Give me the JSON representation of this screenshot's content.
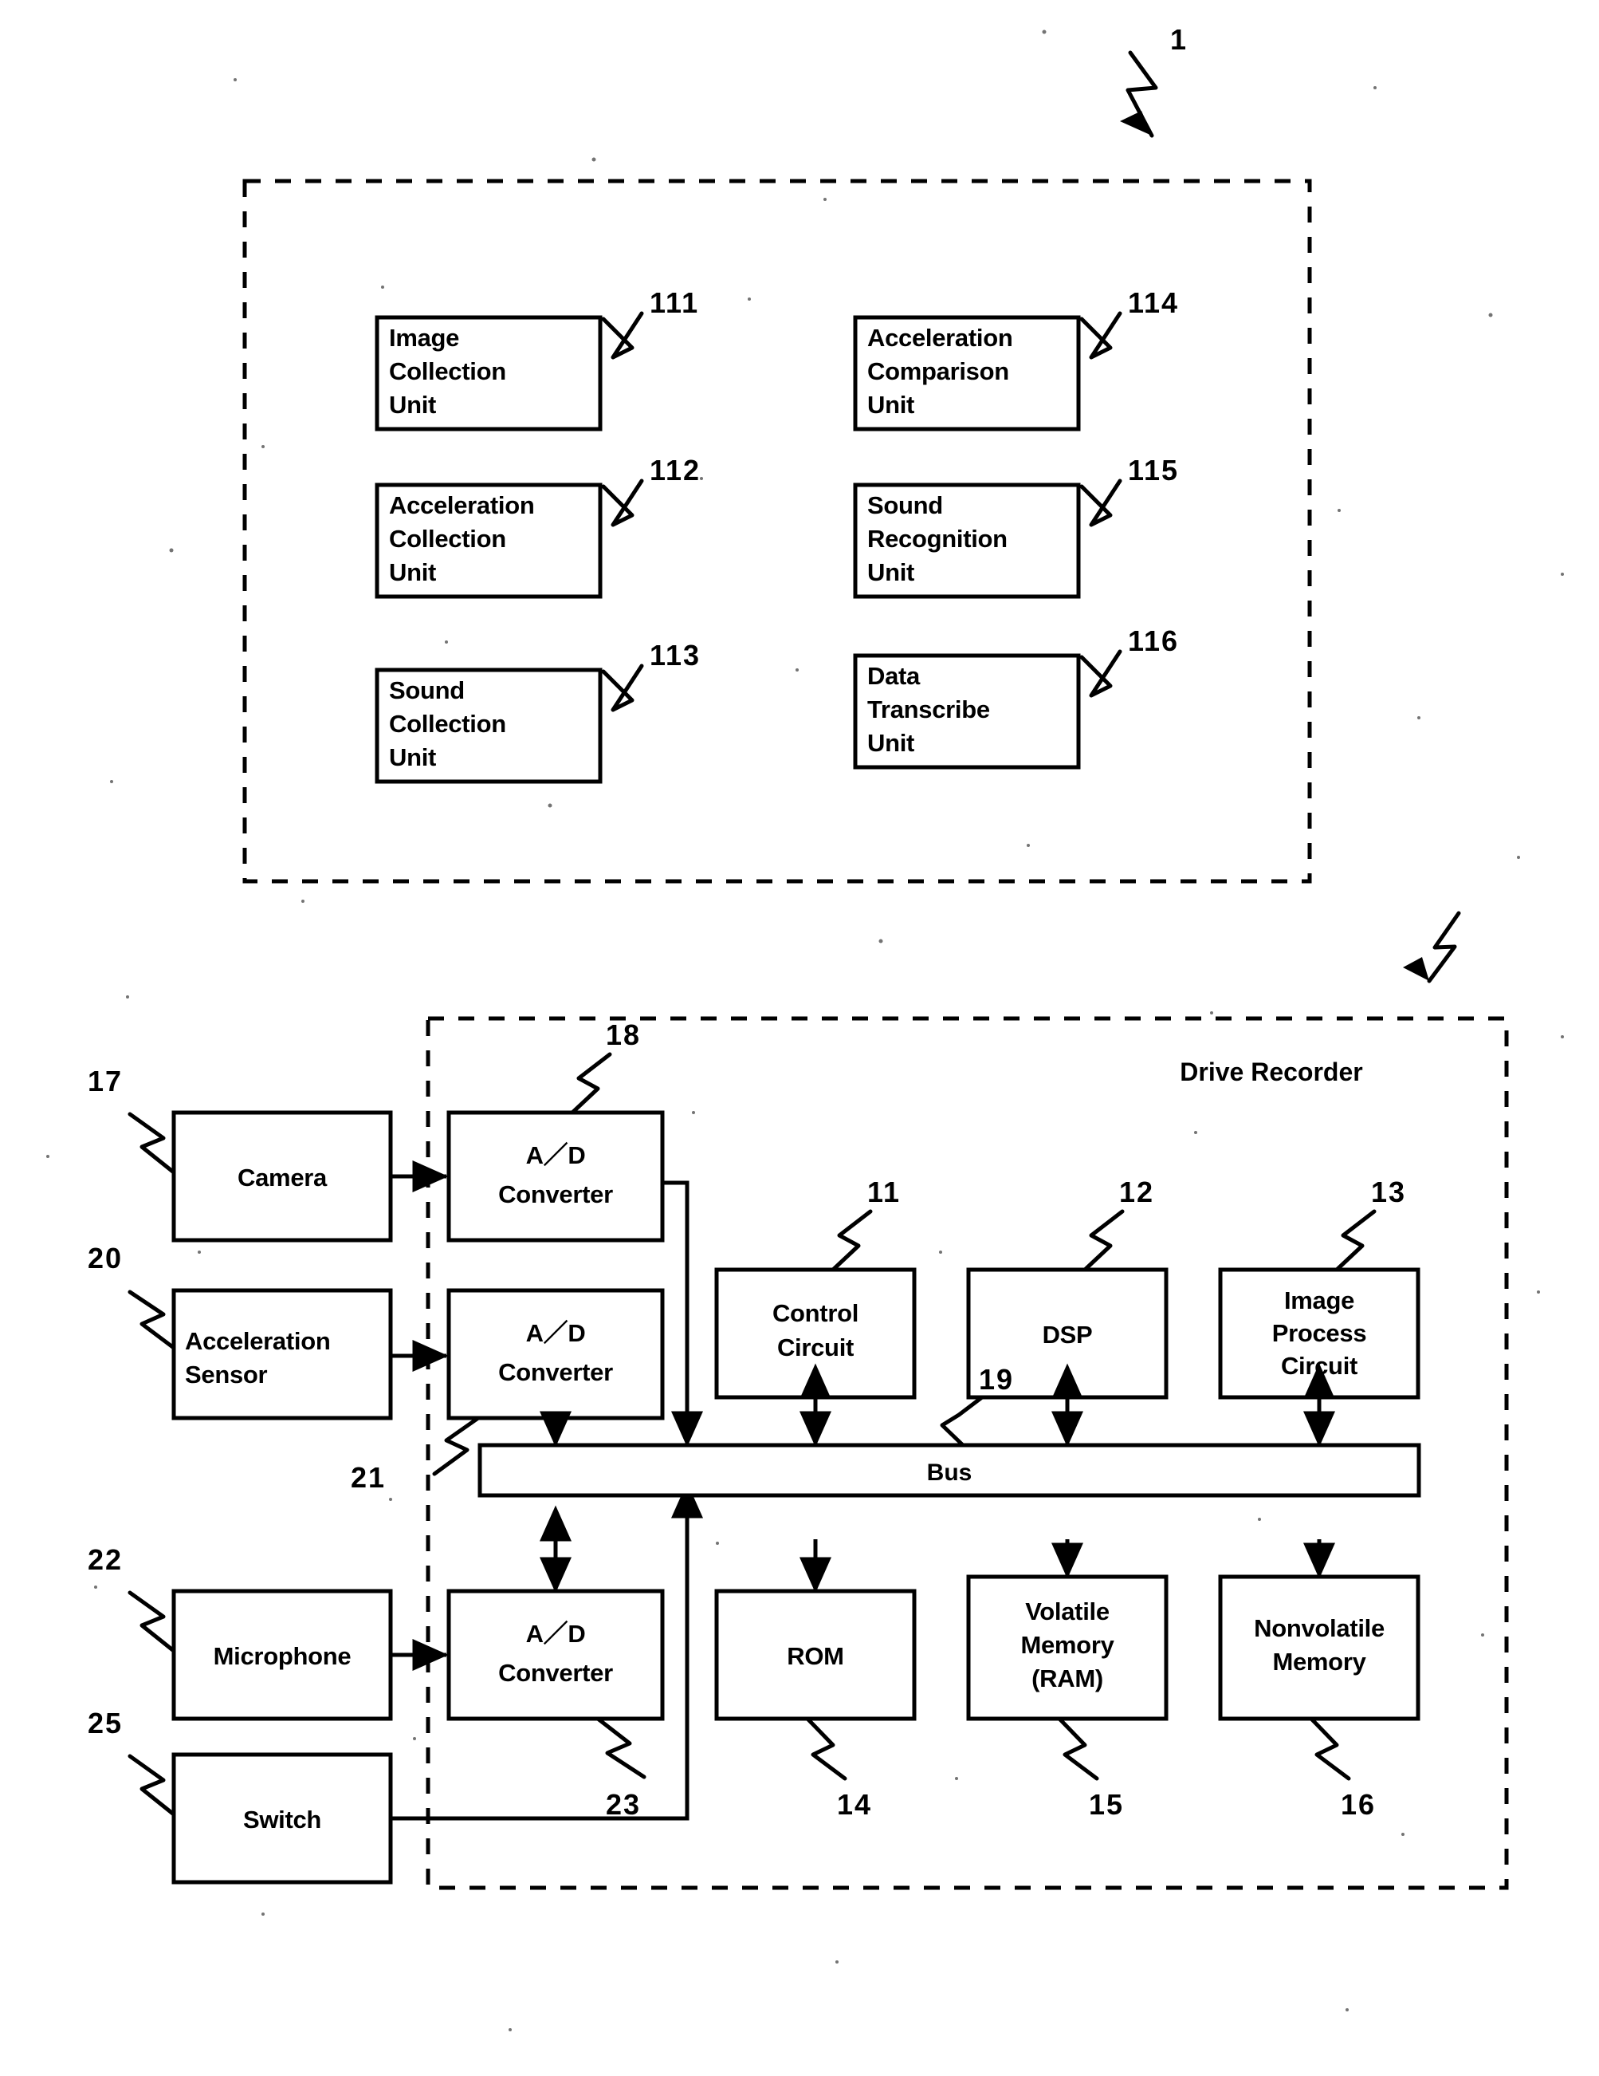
{
  "figure": {
    "top_reference": "1",
    "drive_recorder_title": "Drive Recorder",
    "bus_label": "Bus"
  },
  "upper_section": {
    "reference": "1",
    "left_column": [
      {
        "label_lines": [
          "Image",
          "Collection",
          "Unit"
        ],
        "ref": "111",
        "name": "image-collection-unit"
      },
      {
        "label_lines": [
          "Acceleration",
          "Collection",
          "Unit"
        ],
        "ref": "112",
        "name": "acceleration-collection-unit"
      },
      {
        "label_lines": [
          "Sound",
          "Collection",
          "Unit"
        ],
        "ref": "113",
        "name": "sound-collection-unit"
      }
    ],
    "right_column": [
      {
        "label_lines": [
          "Acceleration",
          "Comparison",
          "Unit"
        ],
        "ref": "114",
        "name": "acceleration-comparison-unit"
      },
      {
        "label_lines": [
          "Sound",
          "Recognition",
          "Unit"
        ],
        "ref": "115",
        "name": "sound-recognition-unit"
      },
      {
        "label_lines": [
          "Data",
          "Transcribe",
          "Unit"
        ],
        "ref": "116",
        "name": "data-transcribe-unit"
      }
    ],
    "blocks": {
      "b111_l1": "Image",
      "b111_l2": "Collection",
      "b111_l3": "Unit",
      "b112_l1": "Acceleration",
      "b112_l2": "Collection",
      "b112_l3": "Unit",
      "b113_l1": "Sound",
      "b113_l2": "Collection",
      "b113_l3": "Unit",
      "b114_l1": "Acceleration",
      "b114_l2": "Comparison",
      "b114_l3": "Unit",
      "b115_l1": "Sound",
      "b115_l2": "Recognition",
      "b115_l3": "Unit",
      "b116_l1": "Data",
      "b116_l2": "Transcribe",
      "b116_l3": "Unit",
      "r111": "111",
      "r112": "112",
      "r113": "113",
      "r114": "114",
      "r115": "115",
      "r116": "116"
    }
  },
  "lower_section": {
    "title": "Drive Recorder",
    "external_devices": {
      "camera_label": "Camera",
      "camera_ref": "17",
      "accel_l1": "Acceleration",
      "accel_l2": "Sensor",
      "accel_ref": "20",
      "mic_label": "Microphone",
      "mic_ref": "22",
      "switch_label": "Switch",
      "switch_ref": "25"
    },
    "converters": {
      "ad1_l1": "A／D",
      "ad1_l2": "Converter",
      "ad1_ref": "18",
      "ad2_l1": "A／D",
      "ad2_l2": "Converter",
      "ad2_ref": "21",
      "ad3_l1": "A／D",
      "ad3_l2": "Converter",
      "ad3_ref": "23"
    },
    "circuits": {
      "control_l1": "Control",
      "control_l2": "Circuit",
      "control_ref": "11",
      "dsp_label": "DSP",
      "dsp_ref": "12",
      "imgproc_l1": "Image",
      "imgproc_l2": "Process",
      "imgproc_l3": "Circuit",
      "imgproc_ref": "13"
    },
    "bus": {
      "label": "Bus",
      "ref": "19"
    },
    "memories": {
      "rom_label": "ROM",
      "rom_ref": "14",
      "ram_l1": "Volatile",
      "ram_l2": "Memory",
      "ram_l3": "(RAM)",
      "ram_ref": "15",
      "nvm_l1": "Nonvolatile",
      "nvm_l2": "Memory",
      "nvm_ref": "16"
    }
  }
}
